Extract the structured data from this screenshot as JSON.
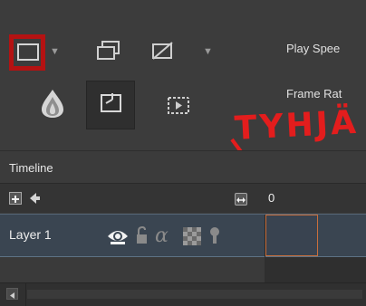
{
  "toolbar": {
    "play_speed_label": "Play Spee",
    "frame_rate_label": "Frame Rat"
  },
  "annotation": {
    "text": "TYHJÄ",
    "color": "#e31d1d"
  },
  "timeline": {
    "title": "Timeline",
    "current_frame": "0",
    "layers": [
      {
        "name": "Layer 1"
      }
    ]
  },
  "colors": {
    "highlight_box": "#b41212",
    "frame_cell_border": "#c86e3c",
    "selected_row": "#3a4551"
  },
  "icons": [
    "new-frame-icon",
    "duplicate-frame-icon",
    "delete-frame-icon",
    "onion-skin-icon",
    "keyframe-icon",
    "insert-keyframe-icon",
    "add-layer-icon",
    "left-arrow-icon",
    "fit-frames-icon",
    "visibility-eye-icon",
    "lock-icon",
    "alpha-lock-icon",
    "transparency-checker-icon",
    "pin-icon",
    "scroll-left-icon"
  ]
}
